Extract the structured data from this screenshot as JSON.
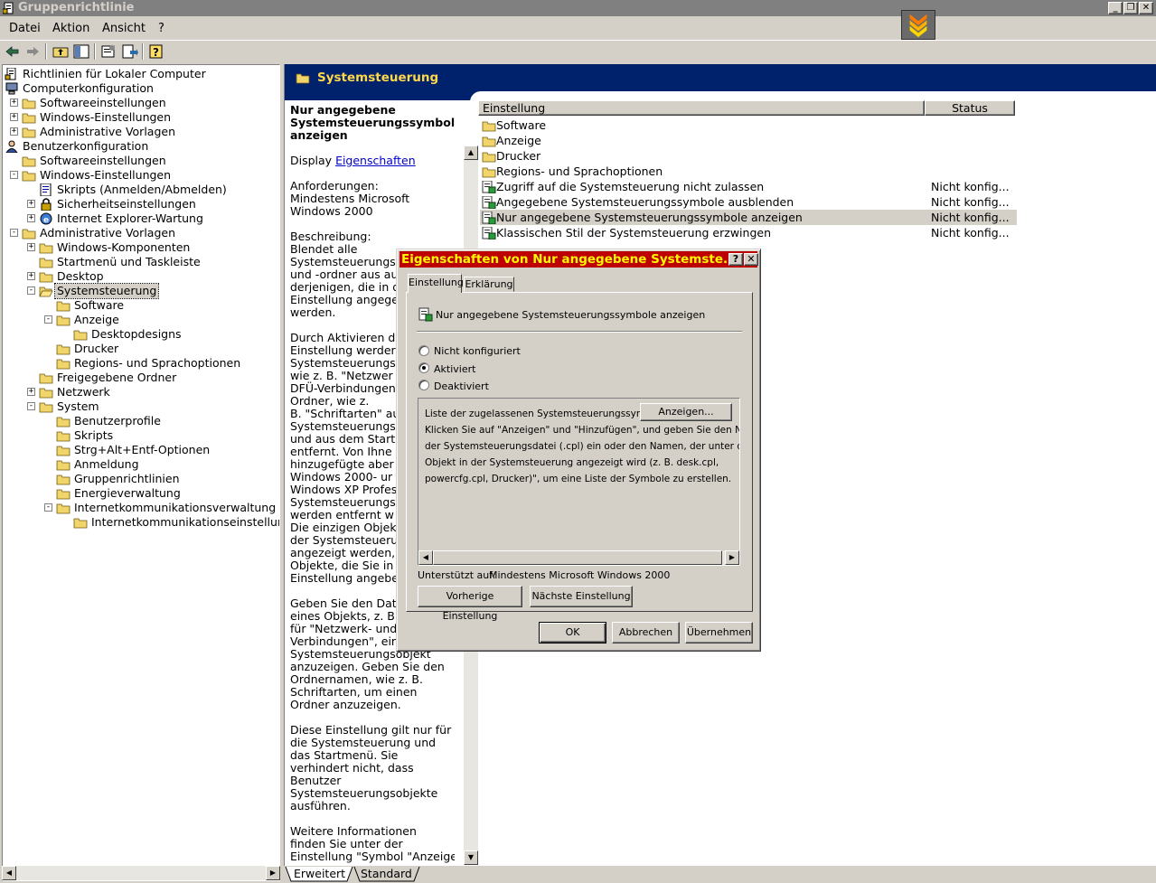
{
  "window": {
    "title": "Gruppenrichtlinie"
  },
  "menu": {
    "datei": "Datei",
    "aktion": "Aktion",
    "ansicht": "Ansicht",
    "help": "?"
  },
  "tree": [
    {
      "label": "Richtlinien für Lokaler Computer",
      "level": 0,
      "expander": "none",
      "icon": "policy-icon"
    },
    {
      "label": "Computerkonfiguration",
      "level": 0,
      "expander": "minus",
      "icon": "computer-icon"
    },
    {
      "label": "Softwareeinstellungen",
      "level": 1,
      "expander": "plus",
      "icon": "folder-icon"
    },
    {
      "label": "Windows-Einstellungen",
      "level": 1,
      "expander": "plus",
      "icon": "folder-icon"
    },
    {
      "label": "Administrative Vorlagen",
      "level": 1,
      "expander": "plus",
      "icon": "folder-icon"
    },
    {
      "label": "Benutzerkonfiguration",
      "level": 0,
      "expander": "minus",
      "icon": "user-icon"
    },
    {
      "label": "Softwareeinstellungen",
      "level": 1,
      "expander": "none",
      "icon": "folder-icon"
    },
    {
      "label": "Windows-Einstellungen",
      "level": 1,
      "expander": "minus",
      "icon": "folder-icon"
    },
    {
      "label": "Skripts (Anmelden/Abmelden)",
      "level": 2,
      "expander": "none",
      "icon": "script-icon"
    },
    {
      "label": "Sicherheitseinstellungen",
      "level": 2,
      "expander": "plus",
      "icon": "security-icon"
    },
    {
      "label": "Internet Explorer-Wartung",
      "level": 2,
      "expander": "plus",
      "icon": "ie-icon"
    },
    {
      "label": "Administrative Vorlagen",
      "level": 1,
      "expander": "minus",
      "icon": "folder-icon"
    },
    {
      "label": "Windows-Komponenten",
      "level": 2,
      "expander": "plus",
      "icon": "folder-icon"
    },
    {
      "label": "Startmenü und Taskleiste",
      "level": 2,
      "expander": "none",
      "icon": "folder-icon"
    },
    {
      "label": "Desktop",
      "level": 2,
      "expander": "plus",
      "icon": "folder-icon"
    },
    {
      "label": "Systemsteuerung",
      "level": 2,
      "expander": "minus",
      "icon": "folder-open-icon",
      "selected": true
    },
    {
      "label": "Software",
      "level": 3,
      "expander": "none",
      "icon": "folder-icon"
    },
    {
      "label": "Anzeige",
      "level": 3,
      "expander": "minus",
      "icon": "folder-icon"
    },
    {
      "label": "Desktopdesigns",
      "level": 4,
      "expander": "none",
      "icon": "folder-icon"
    },
    {
      "label": "Drucker",
      "level": 3,
      "expander": "none",
      "icon": "folder-icon"
    },
    {
      "label": "Regions- und Sprachoptionen",
      "level": 3,
      "expander": "none",
      "icon": "folder-icon"
    },
    {
      "label": "Freigegebene Ordner",
      "level": 2,
      "expander": "none",
      "icon": "folder-icon"
    },
    {
      "label": "Netzwerk",
      "level": 2,
      "expander": "plus",
      "icon": "folder-icon"
    },
    {
      "label": "System",
      "level": 2,
      "expander": "minus",
      "icon": "folder-icon"
    },
    {
      "label": "Benutzerprofile",
      "level": 3,
      "expander": "none",
      "icon": "folder-icon"
    },
    {
      "label": "Skripts",
      "level": 3,
      "expander": "none",
      "icon": "folder-icon"
    },
    {
      "label": "Strg+Alt+Entf-Optionen",
      "level": 3,
      "expander": "none",
      "icon": "folder-icon"
    },
    {
      "label": "Anmeldung",
      "level": 3,
      "expander": "none",
      "icon": "folder-icon"
    },
    {
      "label": "Gruppenrichtlinien",
      "level": 3,
      "expander": "none",
      "icon": "folder-icon"
    },
    {
      "label": "Energieverwaltung",
      "level": 3,
      "expander": "none",
      "icon": "folder-icon"
    },
    {
      "label": "Internetkommunikationsverwaltung",
      "level": 3,
      "expander": "minus",
      "icon": "folder-icon"
    },
    {
      "label": "Internetkommunikationseinstellungen",
      "level": 4,
      "expander": "none",
      "icon": "folder-icon"
    }
  ],
  "right": {
    "header_title": "Systemsteuerung",
    "ext": {
      "setting_title": "Nur angegebene Systemsteuerungssymbole anzeigen",
      "display_prefix": "Display",
      "display_link": "Eigenschaften",
      "requirements": [
        "Anforderungen:",
        "Mindestens Microsoft",
        "Windows 2000"
      ],
      "description_lines": [
        "Beschreibung:",
        "Blendet alle",
        "Systemsteuerungs",
        "und -ordner aus au",
        "derjenigen, die in d",
        "Einstellung angege",
        "werden.",
        "",
        "Durch Aktivieren di",
        "Einstellung werder",
        "Systemsteuerungs",
        "wie z. B. \"Netzwer",
        "DFÜ-Verbindungen",
        "Ordner, wie z.",
        "B. \"Schriftarten\" au",
        "Systemsteuerungs",
        "und aus dem Start",
        "entfernt. Von Ihne",
        "hinzugefügte aber",
        "Windows 2000- ur",
        "Windows XP Profes",
        "Systemsteuerungs",
        "werden entfernt w",
        "Die einzigen Objek",
        "der Systemsteueru",
        "angezeigt werden,",
        "Objekte, die Sie in",
        "Einstellung angebe",
        "",
        "Geben Sie den Dat",
        "eines Objekts, z. B",
        "für \"Netzwerk- und",
        "Verbindungen\", eir",
        "Systemsteuerungsobjekt",
        "anzuzeigen. Geben Sie den",
        "Ordnernamen, wie z. B.",
        "Schriftarten, um einen",
        "Ordner anzuzeigen.",
        "",
        "Diese Einstellung gilt nur für",
        "die Systemsteuerung und",
        "das Startmenü. Sie",
        "verhindert nicht, dass",
        "Benutzer",
        "Systemsteuerungsobjekte",
        "ausführen.",
        "",
        "Weitere Informationen",
        "finden Sie unter der",
        "Einstellung \"Symbol \"Anzeige"
      ]
    },
    "columns": {
      "setting": "Einstellung",
      "status": "Status"
    },
    "rows": [
      {
        "name": "Software",
        "status": "",
        "icon": "folder-icon"
      },
      {
        "name": "Anzeige",
        "status": "",
        "icon": "folder-icon"
      },
      {
        "name": "Drucker",
        "status": "",
        "icon": "folder-icon"
      },
      {
        "name": "Regions- und Sprachoptionen",
        "status": "",
        "icon": "folder-icon"
      },
      {
        "name": "Zugriff auf die Systemsteuerung nicht zulassen",
        "status": "Nicht konfig...",
        "icon": "policy-setting-icon"
      },
      {
        "name": "Angegebene Systemsteuerungssymbole ausblenden",
        "status": "Nicht konfig...",
        "icon": "policy-setting-icon"
      },
      {
        "name": "Nur angegebene Systemsteuerungssymbole anzeigen",
        "status": "Nicht konfig...",
        "icon": "policy-setting-icon",
        "highlight": true
      },
      {
        "name": "Klassischen Stil der Systemsteuerung erzwingen",
        "status": "Nicht konfig...",
        "icon": "policy-setting-icon"
      }
    ],
    "tabs": {
      "extended": "Erweitert",
      "standard": "Standard"
    }
  },
  "dialog": {
    "title": "Eigenschaften von Nur angegebene Systemste...",
    "tabs": {
      "setting": "Einstellung",
      "explain": "Erklärung"
    },
    "setting_name": "Nur angegebene Systemsteuerungssymbole anzeigen",
    "radios": {
      "not_configured": "Nicht konfiguriert",
      "enabled": "Aktiviert",
      "disabled": "Deaktiviert",
      "selected": "enabled"
    },
    "options": {
      "list_label": "Liste der zugelassenen Systemsteuerungssymbole",
      "show_button": "Anzeigen...",
      "help_lines": [
        "Klicken Sie auf \"Anzeigen\" und \"Hinzufügen\", und geben Sie den Namen",
        "der Systemsteuerungsdatei (.cpl) ein oder den Namen, der unter dem",
        "Objekt in der Systemsteuerung angezeigt wird (z. B. desk.cpl,",
        "powercfg.cpl, Drucker)\", um eine Liste der Symbole zu erstellen."
      ]
    },
    "supported_label": "Unterstützt auf:",
    "supported_value": "Mindestens Microsoft Windows 2000",
    "prev_button": "Vorherige Einstellung",
    "next_button": "Nächste Einstellung",
    "ok_button": "OK",
    "cancel_button": "Abbrechen",
    "apply_button": "Übernehmen"
  }
}
